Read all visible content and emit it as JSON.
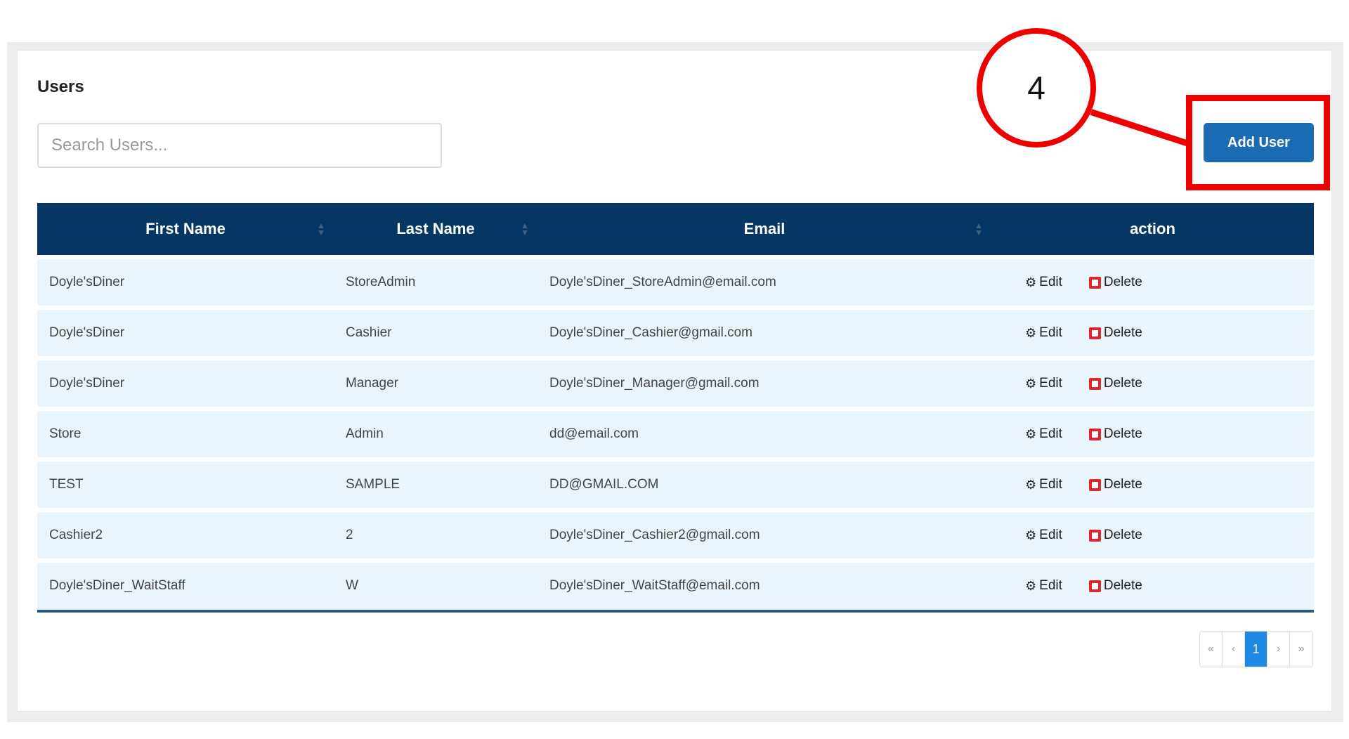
{
  "page": {
    "title": "Users",
    "search_placeholder": "Search Users...",
    "add_user_label": "Add User"
  },
  "callout": {
    "number": "4",
    "color": "#ee0000"
  },
  "table": {
    "headers": {
      "first_name": "First Name",
      "last_name": "Last Name",
      "email": "Email",
      "action": "action"
    },
    "rows": [
      {
        "first": "Doyle'sDiner",
        "last": "StoreAdmin",
        "email": "Doyle'sDiner_StoreAdmin@email.com"
      },
      {
        "first": "Doyle'sDiner",
        "last": "Cashier",
        "email": "Doyle'sDiner_Cashier@gmail.com"
      },
      {
        "first": "Doyle'sDiner",
        "last": "Manager",
        "email": "Doyle'sDiner_Manager@gmail.com"
      },
      {
        "first": "Store",
        "last": "Admin",
        "email": "dd@email.com"
      },
      {
        "first": "TEST",
        "last": "SAMPLE",
        "email": "DD@GMAIL.COM"
      },
      {
        "first": "Cashier2",
        "last": "2",
        "email": "Doyle'sDiner_Cashier2@gmail.com"
      },
      {
        "first": "Doyle'sDiner_WaitStaff",
        "last": "W",
        "email": "Doyle'sDiner_WaitStaff@email.com"
      }
    ],
    "edit_label": "Edit",
    "delete_label": "Delete"
  },
  "pagination": {
    "first": "«",
    "prev": "‹",
    "current": "1",
    "next": "›",
    "last": "»"
  },
  "colors": {
    "header_bg": "#063764",
    "row_bg": "#eaf4fd",
    "primary": "#1c6bb5",
    "delete": "#e0262c",
    "page_active": "#1e88e5"
  }
}
